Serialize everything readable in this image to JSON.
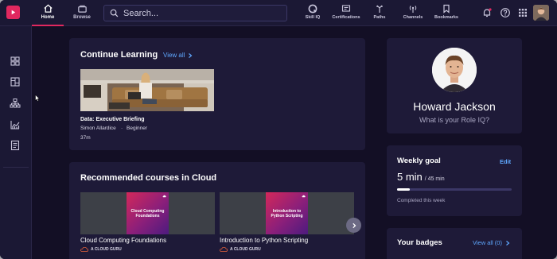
{
  "topnav": {
    "home_label": "Home",
    "browse_label": "Browse",
    "search_placeholder": "Search...",
    "tools": [
      {
        "label": "Skill IQ",
        "icon": "skill-iq-icon"
      },
      {
        "label": "Certifications",
        "icon": "certifications-icon"
      },
      {
        "label": "Paths",
        "icon": "paths-icon"
      },
      {
        "label": "Channels",
        "icon": "channels-icon"
      },
      {
        "label": "Bookmarks",
        "icon": "bookmarks-icon"
      }
    ]
  },
  "sidebar": {
    "icons": [
      "dashboard-icon",
      "catalog-icon",
      "org-chart-icon",
      "analytics-icon",
      "notes-icon"
    ]
  },
  "continue_learning": {
    "title": "Continue Learning",
    "view_all": "View all",
    "course": {
      "title": "Data: Executive Briefing",
      "author": "Simon Allardice",
      "separator": "·",
      "level": "Beginner",
      "duration": "37m"
    }
  },
  "recommended": {
    "title": "Recommended courses in Cloud",
    "courses": [
      {
        "name": "Cloud Computing Foundations",
        "cover_text": "Cloud Computing Foundations",
        "provider": "A CLOUD GURU"
      },
      {
        "name": "Introduction to Python Scripting",
        "cover_text": "Introduction to Python Scripting",
        "provider": "A CLOUD GURU"
      }
    ]
  },
  "profile": {
    "name": "Howard Jackson",
    "role_prompt": "What is your Role IQ?"
  },
  "weekly_goal": {
    "title": "Weekly goal",
    "edit": "Edit",
    "value": "5 min",
    "target": "/ 45 min",
    "progress_fraction": 0.11,
    "status": "Completed this week"
  },
  "badges": {
    "title": "Your badges",
    "view_all": "View all (0)"
  },
  "colors": {
    "accent": "#e1285f",
    "link": "#5fa8ff",
    "background": "#130f25",
    "card": "#1e1a38"
  }
}
